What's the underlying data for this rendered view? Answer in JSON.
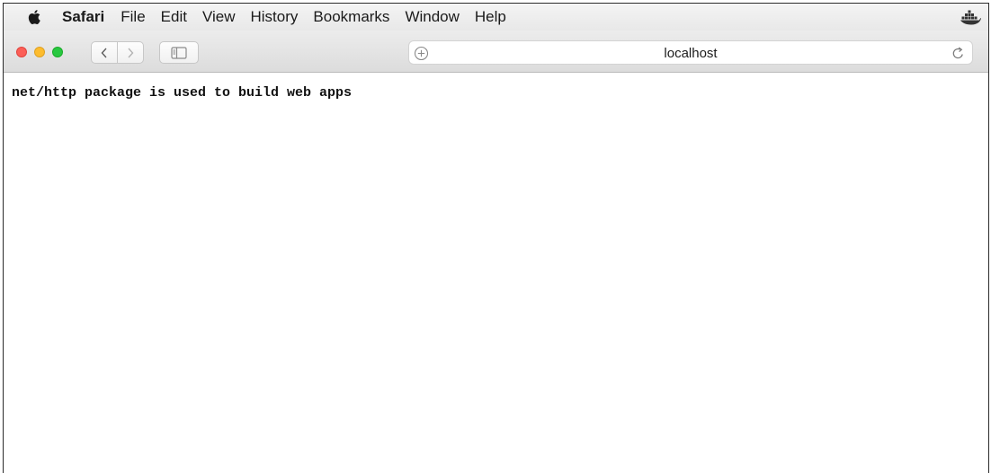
{
  "menubar": {
    "app_name": "Safari",
    "items": [
      "File",
      "Edit",
      "View",
      "History",
      "Bookmarks",
      "Window",
      "Help"
    ],
    "apple_icon": "apple-logo-icon",
    "tray_icon": "docker-whale-icon"
  },
  "toolbar": {
    "traffic_lights": {
      "close": "#fc5f57",
      "minimize": "#fdbc2e",
      "zoom": "#28c840"
    },
    "back_icon": "chevron-left-icon",
    "forward_icon": "chevron-right-icon",
    "sidebar_icon": "sidebar-icon",
    "address": {
      "url": "localhost",
      "left_icon": "plus-circle-icon",
      "right_icon": "reload-icon"
    }
  },
  "page": {
    "body_text": "net/http package is used to build web apps"
  }
}
